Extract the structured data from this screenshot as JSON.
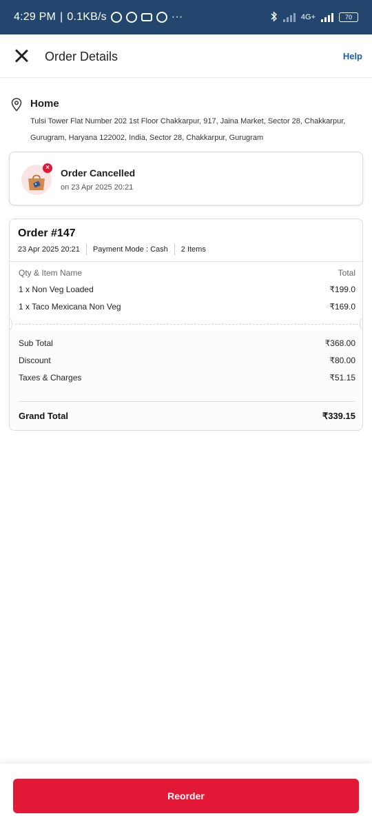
{
  "status_bar": {
    "time": "4:29 PM",
    "separator": "|",
    "net_speed": "0.1KB/s",
    "more": "···",
    "network_type": "4G+",
    "battery": "70"
  },
  "header": {
    "title": "Order Details",
    "help_label": "Help"
  },
  "address": {
    "label": "Home",
    "text": "Tulsi Tower Flat Number 202 1st Floor Chakkarpur, 917, Jaina Market, Sector 28, Chakkarpur, Gurugram, Haryana 122002, India, Sector 28, Chakkarpur, Gurugram"
  },
  "status_card": {
    "title": "Order Cancelled",
    "date": "on 23 Apr 2025 20:21",
    "icons": [
      "shopping-bag-icon",
      "cancel-badge-icon"
    ],
    "accent": "#e31837"
  },
  "order": {
    "number": "Order #147",
    "datetime": "23 Apr 2025 20:21",
    "payment_mode": "Payment Mode :  Cash",
    "item_count": "2 Items",
    "columns": {
      "item": "Qty & Item Name",
      "total": "Total"
    },
    "items": [
      {
        "name": "1 x Non Veg Loaded",
        "price": "₹199.0"
      },
      {
        "name": "1 x Taco Mexicana Non Veg",
        "price": "₹169.0"
      }
    ],
    "summary": [
      {
        "label": "Sub Total",
        "value": "₹368.00"
      },
      {
        "label": "Discount",
        "value": "₹80.00"
      },
      {
        "label": "Taxes & Charges",
        "value": "₹51.15"
      }
    ],
    "grand_total": {
      "label": "Grand Total",
      "value": "₹339.15"
    }
  },
  "footer": {
    "reorder_label": "Reorder",
    "accent": "#e31837"
  }
}
